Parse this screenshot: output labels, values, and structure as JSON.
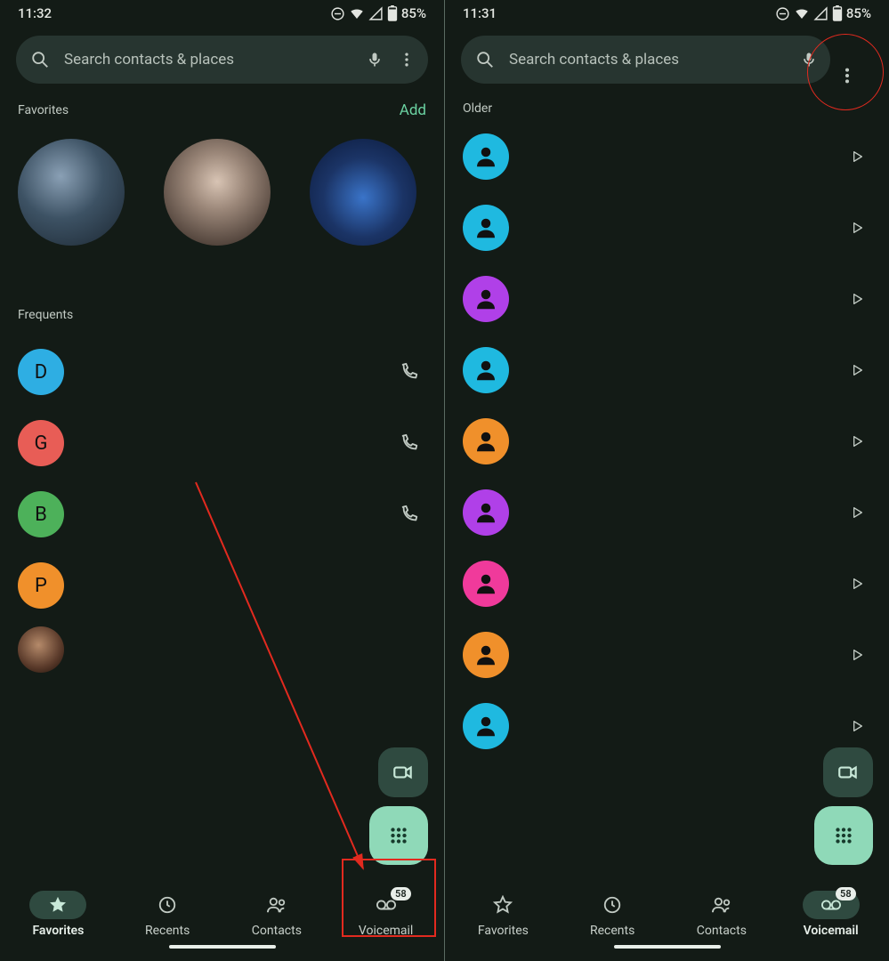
{
  "status": {
    "time_left": "11:32",
    "time_right": "11:31",
    "battery": "85%"
  },
  "search": {
    "placeholder": "Search contacts & places"
  },
  "left": {
    "favorites_label": "Favorites",
    "add_label": "Add",
    "frequents_label": "Frequents",
    "frequents": [
      {
        "letter": "D",
        "color": "#2eaee3"
      },
      {
        "letter": "G",
        "color": "#e85d56"
      },
      {
        "letter": "B",
        "color": "#4db15a"
      },
      {
        "letter": "P",
        "color": "#f0902b"
      }
    ]
  },
  "right": {
    "older_label": "Older",
    "voicemails": [
      {
        "color": "#1fb9e0"
      },
      {
        "color": "#1fb9e0"
      },
      {
        "color": "#b040e8"
      },
      {
        "color": "#1fb9e0"
      },
      {
        "color": "#f0902b"
      },
      {
        "color": "#b040e8"
      },
      {
        "color": "#f03a9b"
      },
      {
        "color": "#f0902b"
      },
      {
        "color": "#1fb9e0"
      }
    ]
  },
  "nav": {
    "favorites": "Favorites",
    "recents": "Recents",
    "contacts": "Contacts",
    "voicemail": "Voicemail",
    "vm_badge": "58"
  },
  "annotation": {
    "arrow_note": "red arrow from center to Voicemail tab",
    "circle_note": "red circle around overflow menu in right screen"
  }
}
